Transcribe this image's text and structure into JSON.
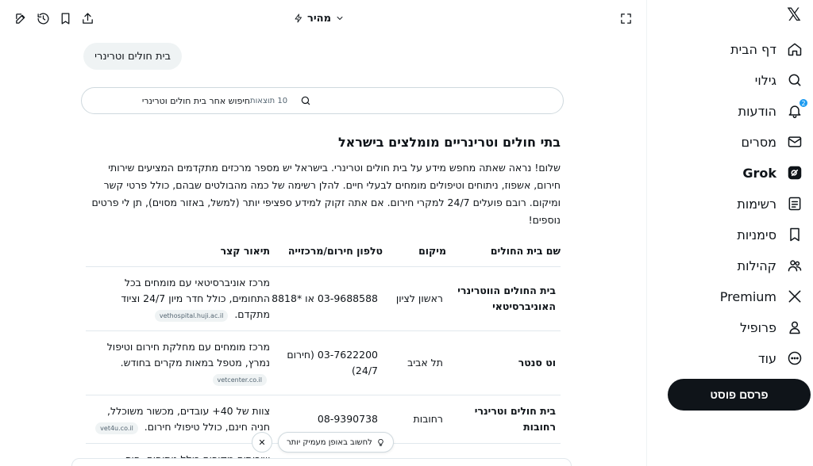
{
  "topbar": {
    "icons": [
      "compose-icon",
      "history-icon",
      "bookmark-icon",
      "share-icon",
      "expand-icon"
    ],
    "model_label": "מהיר"
  },
  "query": {
    "chip_text": "בית חולים וטרינרי"
  },
  "search": {
    "input_value": "חיפוש אחר בית חולים וטרינרי",
    "results_count": "10 תוצאות"
  },
  "answer": {
    "title": "בתי חולים וטרינריים מומלצים בישראל",
    "intro": "שלום! נראה שאתה מחפש מידע על בית חולים וטרינרי. בישראל יש מספר מרכזים מתקדמים המציעים שירותי חירום, אשפוז, ניתוחים וטיפולים מומחים לבעלי חיים. להלן רשימה של כמה מהבולטים שבהם, כולל פרטי קשר ומיקום. רובם פועלים 24/7 למקרי חירום. אם אתה זקוק למידע ספציפי יותר (למשל, באזור מסוים), תן לי פרטים נוספים!"
  },
  "table": {
    "headers": [
      "שם בית החולים",
      "מיקום",
      "טלפון חירום/מרכזייה",
      "תיאור קצר"
    ],
    "rows": [
      {
        "name": "בית החולים הווטרינרי האוניברסיטאי",
        "location": "ראשון לציון",
        "phone": "03-9688588 או *8818",
        "description": "מרכז אוניברסיטאי עם מומחים בכל התחומים, כולל חדר מיון 24/7 וציוד מתקדם.",
        "source": "vethospital.huji.ac.il"
      },
      {
        "name": "וט סנטר",
        "location": "תל אביב",
        "phone": "03-7622200 (חירום 24/7)",
        "description": "מרכז מומחים עם מחלקת חירום וטיפול נמרץ, מטפל במאות מקרים בחודש.",
        "source": "vetcenter.co.il"
      },
      {
        "name": "בית חולים וטרינרי רחובות",
        "location": "רחובות",
        "phone": "08-9390738",
        "description": "צוות של 40+ עובדים, מכשור משוכלל, חניה חינם, כולל טיפולי חירום.",
        "source": "vet4u.co.il"
      },
      {
        "name": "",
        "location": "",
        "phone": "",
        "description": "שירותים מקיפים כולל ניתוחים, חיס",
        "source": ""
      }
    ]
  },
  "think_deeper": {
    "label": "לחשוב באופן מעמיק יותר",
    "dismiss": "✕"
  },
  "sidebar": {
    "logo": "𝕏",
    "items": [
      {
        "label": "דף הבית",
        "icon": "home-icon"
      },
      {
        "label": "גילוי",
        "icon": "search-icon"
      },
      {
        "label": "הודעות",
        "icon": "bell-icon",
        "badge": "2"
      },
      {
        "label": "מסרים",
        "icon": "mail-icon"
      },
      {
        "label": "Grok",
        "icon": "grok-icon"
      },
      {
        "label": "רשימות",
        "icon": "list-icon"
      },
      {
        "label": "סימניות",
        "icon": "bookmark-icon"
      },
      {
        "label": "קהילות",
        "icon": "communities-icon"
      },
      {
        "label": "Premium",
        "icon": "x-premium-icon"
      },
      {
        "label": "פרופיל",
        "icon": "profile-icon"
      },
      {
        "label": "עוד",
        "icon": "more-icon"
      }
    ],
    "post_label": "פרסם פוסט"
  }
}
